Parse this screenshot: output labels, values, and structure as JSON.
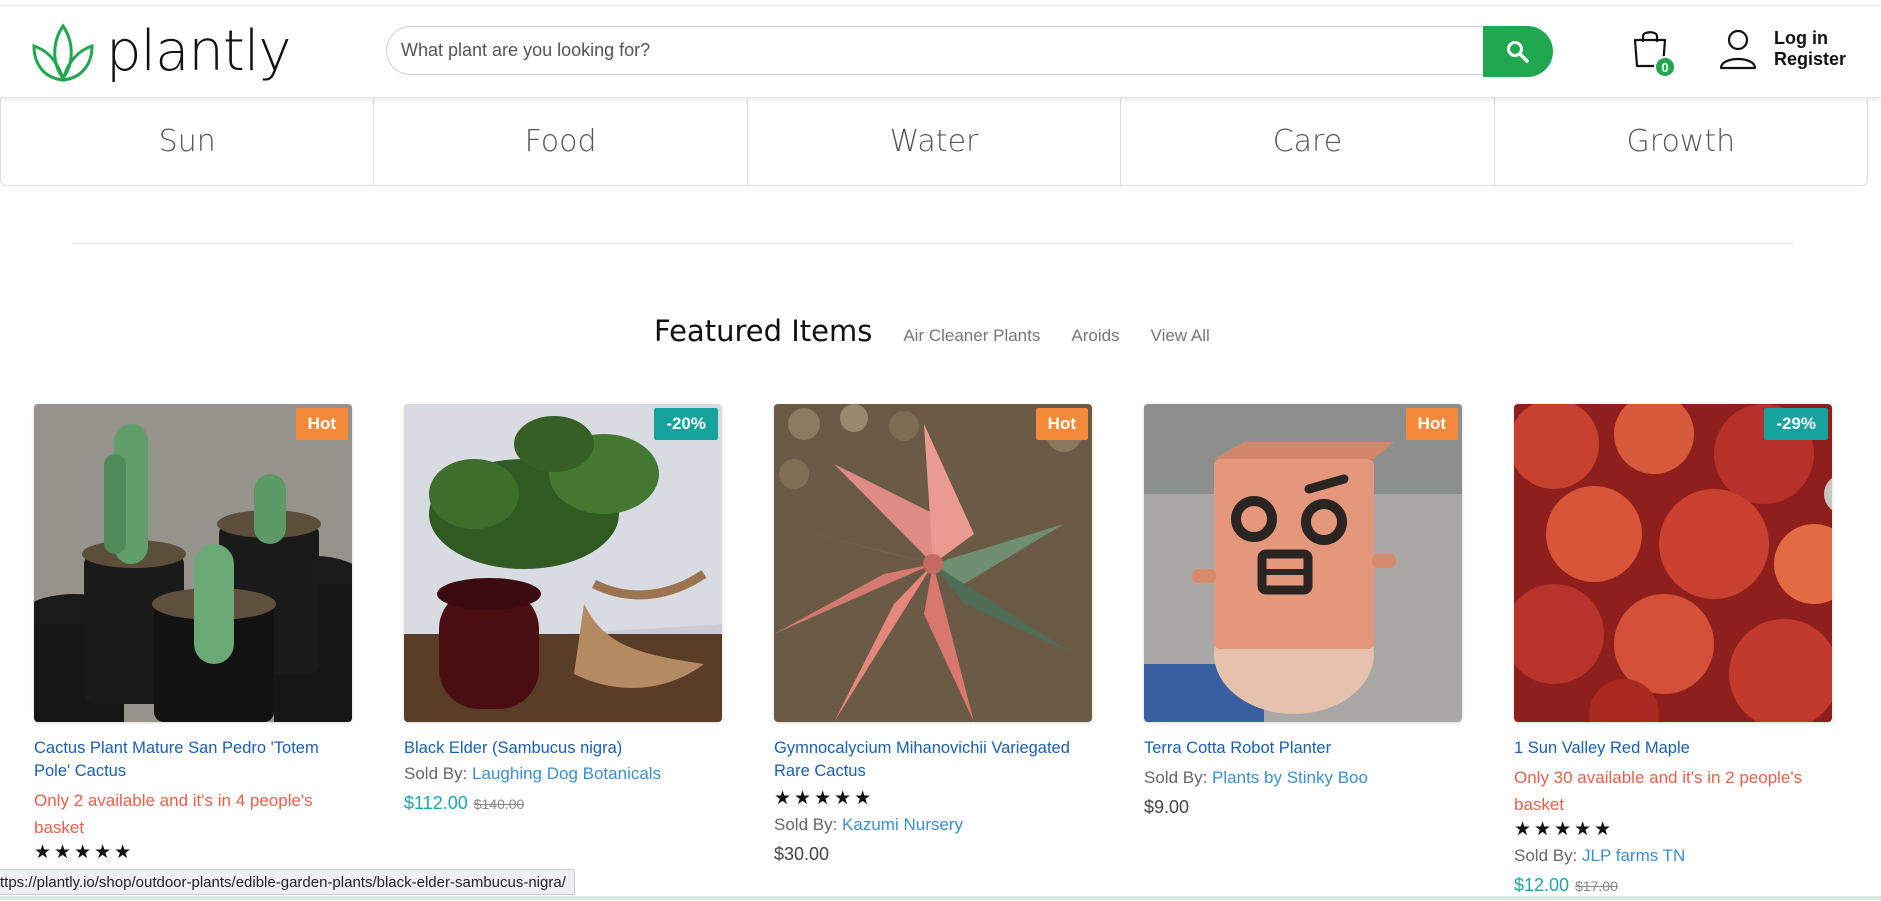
{
  "brand": {
    "name": "plantly",
    "color": "#1fa84f"
  },
  "search": {
    "placeholder": "What plant are you looking for?",
    "value": "",
    "icon": "search-icon"
  },
  "cart": {
    "count": "0",
    "icon": "shopping-bag-icon"
  },
  "account": {
    "login": "Log in",
    "register": "Register",
    "icon": "user-icon"
  },
  "categories": [
    "Sun",
    "Food",
    "Water",
    "Care",
    "Growth"
  ],
  "featured": {
    "title": "Featured Items",
    "tabs": [
      "Air Cleaner Plants",
      "Aroids",
      "View All"
    ]
  },
  "products": [
    {
      "badge": "Hot",
      "badge_color": "#f5893a",
      "title": "Cactus Plant Mature San Pedro 'Totem Pole' Cactus",
      "stock": "Only 2 available and it's in 4 people's basket",
      "stars": "★★★★★"
    },
    {
      "badge": "-20%",
      "badge_color": "#16a39e",
      "title": "Black Elder (Sambucus nigra)",
      "sold_by_label": "Sold By:",
      "seller": "Laughing Dog Botanicals",
      "price": "$112.00",
      "old_price": "$140.00"
    },
    {
      "badge": "Hot",
      "badge_color": "#f5893a",
      "title": "Gymnocalycium Mihanovichii Variegated Rare Cactus",
      "stars": "★★★★★",
      "sold_by_label": "Sold By:",
      "seller": "Kazumi Nursery",
      "price": "$30.00"
    },
    {
      "badge": "Hot",
      "badge_color": "#f5893a",
      "title": "Terra Cotta Robot Planter",
      "sold_by_label": "Sold By:",
      "seller": "Plants by Stinky Boo",
      "price": "$9.00"
    },
    {
      "badge": "-29%",
      "badge_color": "#16a39e",
      "title": "1 Sun Valley Red Maple",
      "stock": "Only 30 available and it's in 2 people's basket",
      "stars": "★★★★★",
      "sold_by_label": "Sold By:",
      "seller": "JLP farms TN",
      "price": "$12.00",
      "old_price": "$17.00"
    }
  ],
  "status_url": "ttps://plantly.io/shop/outdoor-plants/edible-garden-plants/black-elder-sambucus-nigra/"
}
